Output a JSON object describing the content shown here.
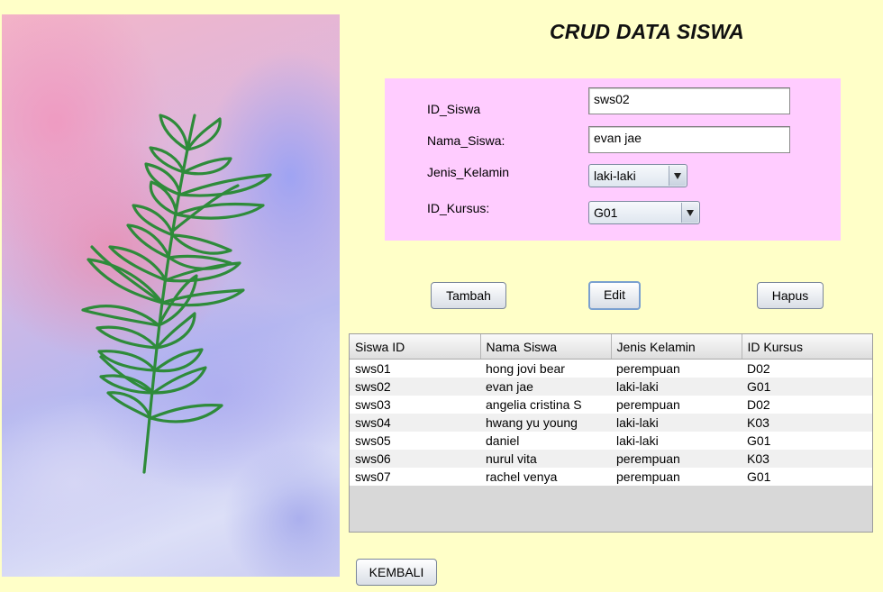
{
  "title": "CRUD DATA SISWA",
  "form": {
    "id_label": "ID_Siswa",
    "id_value": "sws02",
    "nama_label": "Nama_Siswa:",
    "nama_value": "evan jae",
    "jk_label": "Jenis_Kelamin",
    "jk_value": "laki-laki",
    "kursus_label": "ID_Kursus:",
    "kursus_value": "G01"
  },
  "buttons": {
    "tambah": "Tambah",
    "edit": "Edit",
    "hapus": "Hapus",
    "kembali": "KEMBALI"
  },
  "table": {
    "headers": [
      "Siswa ID",
      "Nama Siswa",
      "Jenis Kelamin",
      "ID Kursus"
    ],
    "rows": [
      [
        "sws01",
        "hong jovi bear",
        "perempuan",
        "D02"
      ],
      [
        "sws02",
        "evan jae",
        "laki-laki",
        "G01"
      ],
      [
        "sws03",
        "angelia cristina S",
        "perempuan",
        "D02"
      ],
      [
        "sws04",
        "hwang yu young",
        "laki-laki",
        "K03"
      ],
      [
        "sws05",
        "daniel",
        "laki-laki",
        "G01"
      ],
      [
        "sws06",
        "nurul vita",
        "perempuan",
        "K03"
      ],
      [
        "sws07",
        "rachel venya",
        "perempuan",
        "G01"
      ]
    ]
  },
  "colors": {
    "background": "#ffffc8",
    "form_panel": "#ffccff",
    "leaf": "#2e8b3a"
  },
  "icons": {
    "decorative": "leaf-branch-icon",
    "combo": "chevron-down-icon"
  }
}
